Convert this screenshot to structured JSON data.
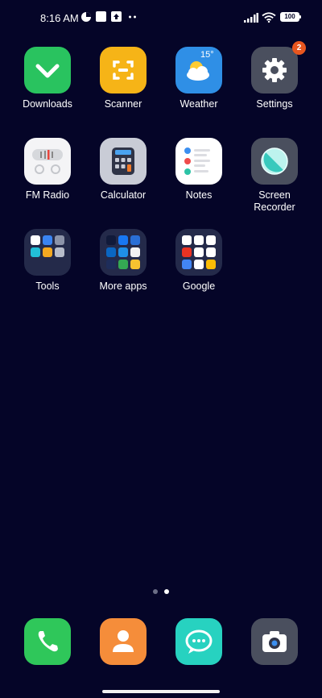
{
  "status_bar": {
    "time": "8:16 AM",
    "battery": "100"
  },
  "apps": [
    {
      "label": "Downloads",
      "icon": "download-icon",
      "bg": "#29c35f"
    },
    {
      "label": "Scanner",
      "icon": "scanner-icon",
      "bg": "#f6b417"
    },
    {
      "label": "Weather",
      "icon": "weather-icon",
      "bg": "#2f8fe6",
      "temp": "15°"
    },
    {
      "label": "Settings",
      "icon": "gear-icon",
      "bg": "#4a4f5e",
      "badge": "2"
    },
    {
      "label": "FM Radio",
      "icon": "radio-icon",
      "bg": "#f4f4f6"
    },
    {
      "label": "Calculator",
      "icon": "calculator-icon",
      "bg": "#c9ccd6"
    },
    {
      "label": "Notes",
      "icon": "notes-icon",
      "bg": "#ffffff"
    },
    {
      "label": "Screen\nRecorder",
      "icon": "screen-recorder-icon",
      "bg": "#4a4f5e"
    },
    {
      "label": "Tools",
      "icon": "folder-icon",
      "bg": "#242a4a"
    },
    {
      "label": "More apps",
      "icon": "folder-icon",
      "bg": "#242a4a"
    },
    {
      "label": "Google",
      "icon": "folder-icon",
      "bg": "#242a4a"
    }
  ],
  "dock": [
    {
      "name": "phone",
      "icon": "phone-icon",
      "bg": "#2fc75a"
    },
    {
      "name": "contacts",
      "icon": "contacts-icon",
      "bg": "#f58d3a"
    },
    {
      "name": "messages",
      "icon": "messages-icon",
      "bg": "#27d2c0"
    },
    {
      "name": "camera",
      "icon": "camera-icon",
      "bg": "#4a4f5e"
    }
  ],
  "page_indicator": {
    "pages": 2,
    "current": 2
  },
  "colors": {
    "wallpaper": "#050528",
    "accent_badge": "#e8561f"
  }
}
